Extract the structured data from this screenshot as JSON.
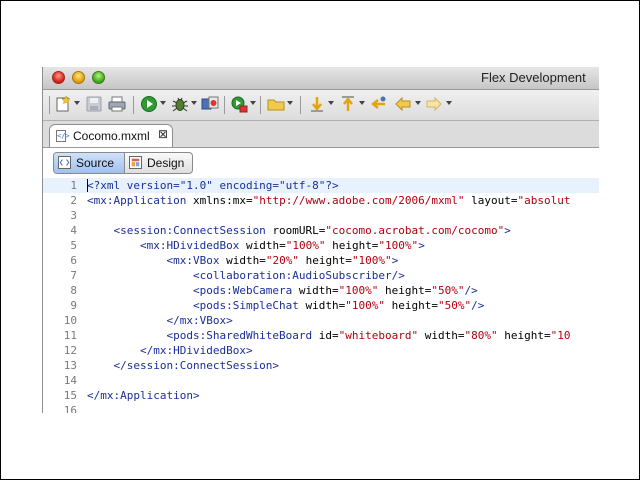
{
  "window": {
    "title": "Flex Development"
  },
  "toolbar": {
    "icons": [
      "new-icon",
      "save-icon",
      "print-icon",
      "run-icon",
      "debug-icon",
      "profile-icon",
      "external-tools-icon",
      "open-type-icon",
      "next-annotation-icon",
      "prev-annotation-icon",
      "last-edit-icon",
      "back-icon",
      "forward-icon"
    ]
  },
  "editor_tab": {
    "label": "Cocomo.mxml",
    "close": "⊠"
  },
  "modes": {
    "source": "Source",
    "design": "Design"
  },
  "code": {
    "lines": [
      {
        "n": "1",
        "seg": [
          {
            "c": "tag",
            "t": "<?xml version=\"1.0\" encoding=\"utf-8\"?>"
          }
        ]
      },
      {
        "n": "2",
        "seg": [
          {
            "c": "tag",
            "t": "<mx:Application "
          },
          {
            "c": "at",
            "t": "xmlns:mx="
          },
          {
            "c": "val",
            "t": "\"http://www.adobe.com/2006/mxml\""
          },
          {
            "c": "at",
            "t": " layout="
          },
          {
            "c": "val",
            "t": "\"absolut"
          }
        ]
      },
      {
        "n": "3",
        "seg": []
      },
      {
        "n": "4",
        "seg": [
          {
            "c": "tag",
            "t": "    <session:ConnectSession "
          },
          {
            "c": "at",
            "t": "roomURL="
          },
          {
            "c": "val",
            "t": "\"cocomo.acrobat.com/cocomo\""
          },
          {
            "c": "tag",
            "t": ">"
          }
        ]
      },
      {
        "n": "5",
        "seg": [
          {
            "c": "tag",
            "t": "        <mx:HDividedBox "
          },
          {
            "c": "at",
            "t": "width="
          },
          {
            "c": "val",
            "t": "\"100%\""
          },
          {
            "c": "at",
            "t": " height="
          },
          {
            "c": "val",
            "t": "\"100%\""
          },
          {
            "c": "tag",
            "t": ">"
          }
        ]
      },
      {
        "n": "6",
        "seg": [
          {
            "c": "tag",
            "t": "            <mx:VBox "
          },
          {
            "c": "at",
            "t": "width="
          },
          {
            "c": "val",
            "t": "\"20%\""
          },
          {
            "c": "at",
            "t": " height="
          },
          {
            "c": "val",
            "t": "\"100%\""
          },
          {
            "c": "tag",
            "t": ">"
          }
        ]
      },
      {
        "n": "7",
        "seg": [
          {
            "c": "tag",
            "t": "                <collaboration:AudioSubscriber/>"
          }
        ]
      },
      {
        "n": "8",
        "seg": [
          {
            "c": "tag",
            "t": "                <pods:WebCamera "
          },
          {
            "c": "at",
            "t": "width="
          },
          {
            "c": "val",
            "t": "\"100%\""
          },
          {
            "c": "at",
            "t": " height="
          },
          {
            "c": "val",
            "t": "\"50%\""
          },
          {
            "c": "tag",
            "t": "/>"
          }
        ]
      },
      {
        "n": "9",
        "seg": [
          {
            "c": "tag",
            "t": "                <pods:SimpleChat "
          },
          {
            "c": "at",
            "t": "width="
          },
          {
            "c": "val",
            "t": "\"100%\""
          },
          {
            "c": "at",
            "t": " height="
          },
          {
            "c": "val",
            "t": "\"50%\""
          },
          {
            "c": "tag",
            "t": "/>"
          }
        ]
      },
      {
        "n": "10",
        "seg": [
          {
            "c": "tag",
            "t": "            </mx:VBox>"
          }
        ]
      },
      {
        "n": "11",
        "seg": [
          {
            "c": "tag",
            "t": "            <pods:SharedWhiteBoard "
          },
          {
            "c": "at",
            "t": "id="
          },
          {
            "c": "val",
            "t": "\"whiteboard\""
          },
          {
            "c": "at",
            "t": " width="
          },
          {
            "c": "val",
            "t": "\"80%\""
          },
          {
            "c": "at",
            "t": " height="
          },
          {
            "c": "val",
            "t": "\"10"
          }
        ]
      },
      {
        "n": "12",
        "seg": [
          {
            "c": "tag",
            "t": "        </mx:HDividedBox>"
          }
        ]
      },
      {
        "n": "13",
        "seg": [
          {
            "c": "tag",
            "t": "    </session:ConnectSession>"
          }
        ]
      },
      {
        "n": "14",
        "seg": []
      },
      {
        "n": "15",
        "seg": [
          {
            "c": "tag",
            "t": "</mx:Application>"
          }
        ]
      },
      {
        "n": "16",
        "seg": []
      }
    ]
  },
  "colors": {
    "tag": "#1a2e9a",
    "value": "#b2000f",
    "current_line": "#e8f2fe"
  }
}
